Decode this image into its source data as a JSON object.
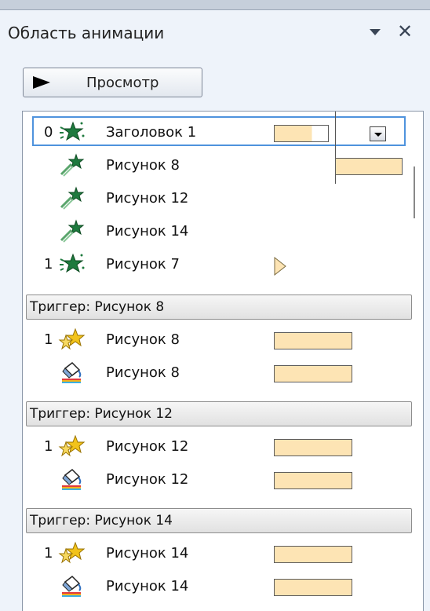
{
  "pane": {
    "title": "Область анимации",
    "play_label": "Просмотр"
  },
  "icons": {
    "dropdown": "chevron-down-icon",
    "close": "close-icon",
    "play": "play-icon",
    "entrance_star": "green-entrance-star-icon",
    "motion_star": "green-motion-star-icon",
    "emphasis_star": "yellow-emphasis-star-icon",
    "paint_bucket": "paint-bucket-icon"
  },
  "colors": {
    "timing_bar": "#fde4b4",
    "selection_border": "#4f93dd",
    "entrance_green": "#1e7a3e",
    "emphasis_yellow": "#f2c31b"
  },
  "animations": [
    {
      "number": "0",
      "label": "Заголовок 1",
      "icon": "entrance_star",
      "selected": true
    },
    {
      "number": "",
      "label": "Рисунок 8",
      "icon": "motion_star"
    },
    {
      "number": "",
      "label": "Рисунок 12",
      "icon": "motion_star"
    },
    {
      "number": "",
      "label": "Рисунок 14",
      "icon": "motion_star"
    },
    {
      "number": "1",
      "label": "Рисунок 7",
      "icon": "entrance_star"
    }
  ],
  "triggers": [
    {
      "title": "Триггер: Рисунок 8",
      "items": [
        {
          "number": "1",
          "label": "Рисунок 8",
          "icon": "emphasis_star"
        },
        {
          "number": "",
          "label": "Рисунок 8",
          "icon": "paint_bucket"
        }
      ]
    },
    {
      "title": "Триггер: Рисунок 12",
      "items": [
        {
          "number": "1",
          "label": "Рисунок 12",
          "icon": "emphasis_star"
        },
        {
          "number": "",
          "label": "Рисунок 12",
          "icon": "paint_bucket"
        }
      ]
    },
    {
      "title": "Триггер: Рисунок 14",
      "items": [
        {
          "number": "1",
          "label": "Рисунок 14",
          "icon": "emphasis_star"
        },
        {
          "number": "",
          "label": "Рисунок 14",
          "icon": "paint_bucket"
        }
      ]
    }
  ]
}
